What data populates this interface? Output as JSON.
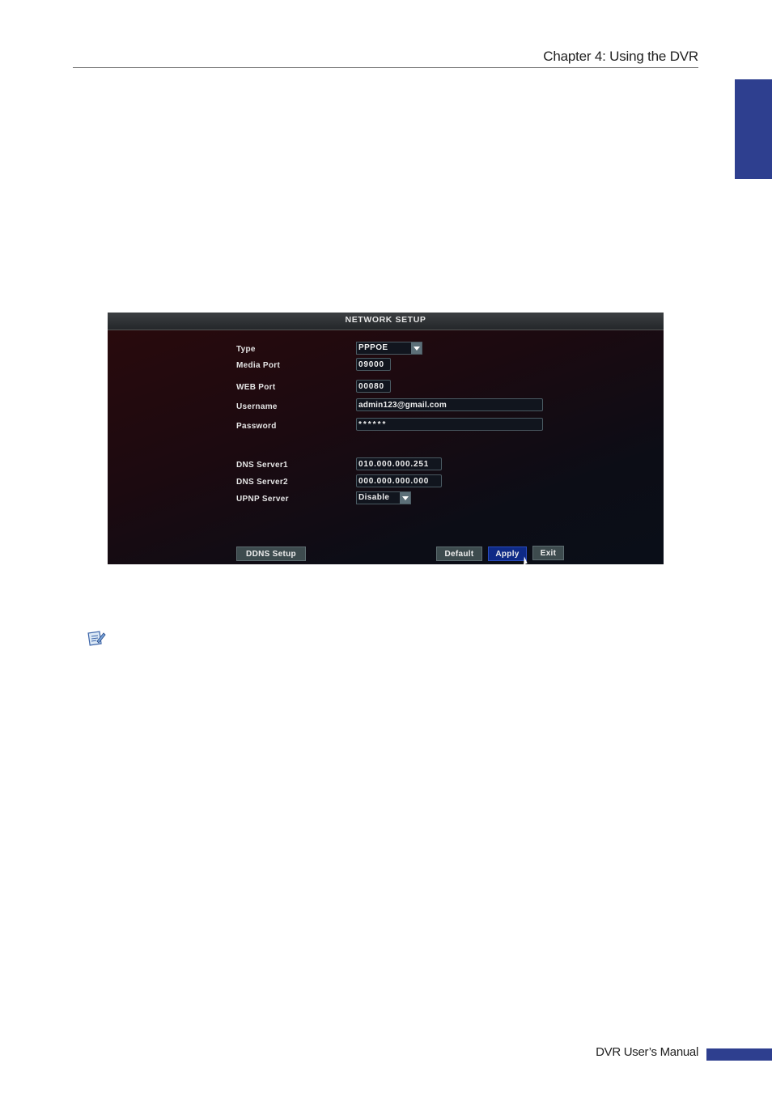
{
  "header": {
    "chapter_title": "Chapter 4: Using the DVR"
  },
  "screen": {
    "title": "NETWORK SETUP",
    "fields": {
      "type": {
        "label": "Type",
        "value": "PPPOE"
      },
      "media_port": {
        "label": "Media Port",
        "value": "09000"
      },
      "web_port": {
        "label": "WEB Port",
        "value": "00080"
      },
      "username": {
        "label": "Username",
        "value": "admin123@gmail.com"
      },
      "password": {
        "label": "Password",
        "value": "******"
      },
      "dns1": {
        "label": "DNS Server1",
        "value": "010.000.000.251"
      },
      "dns2": {
        "label": "DNS Server2",
        "value": "000.000.000.000"
      },
      "upnp": {
        "label": "UPNP Server",
        "value": "Disable"
      }
    },
    "buttons": {
      "ddns": "DDNS Setup",
      "default": "Default",
      "apply": "Apply",
      "exit": "Exit"
    }
  },
  "footer": {
    "manual_title": "DVR User’s Manual"
  },
  "colors": {
    "accent": "#2e3f8f"
  },
  "icons": {
    "note": "note-pencil-icon",
    "cursor": "mouse-cursor-icon"
  }
}
